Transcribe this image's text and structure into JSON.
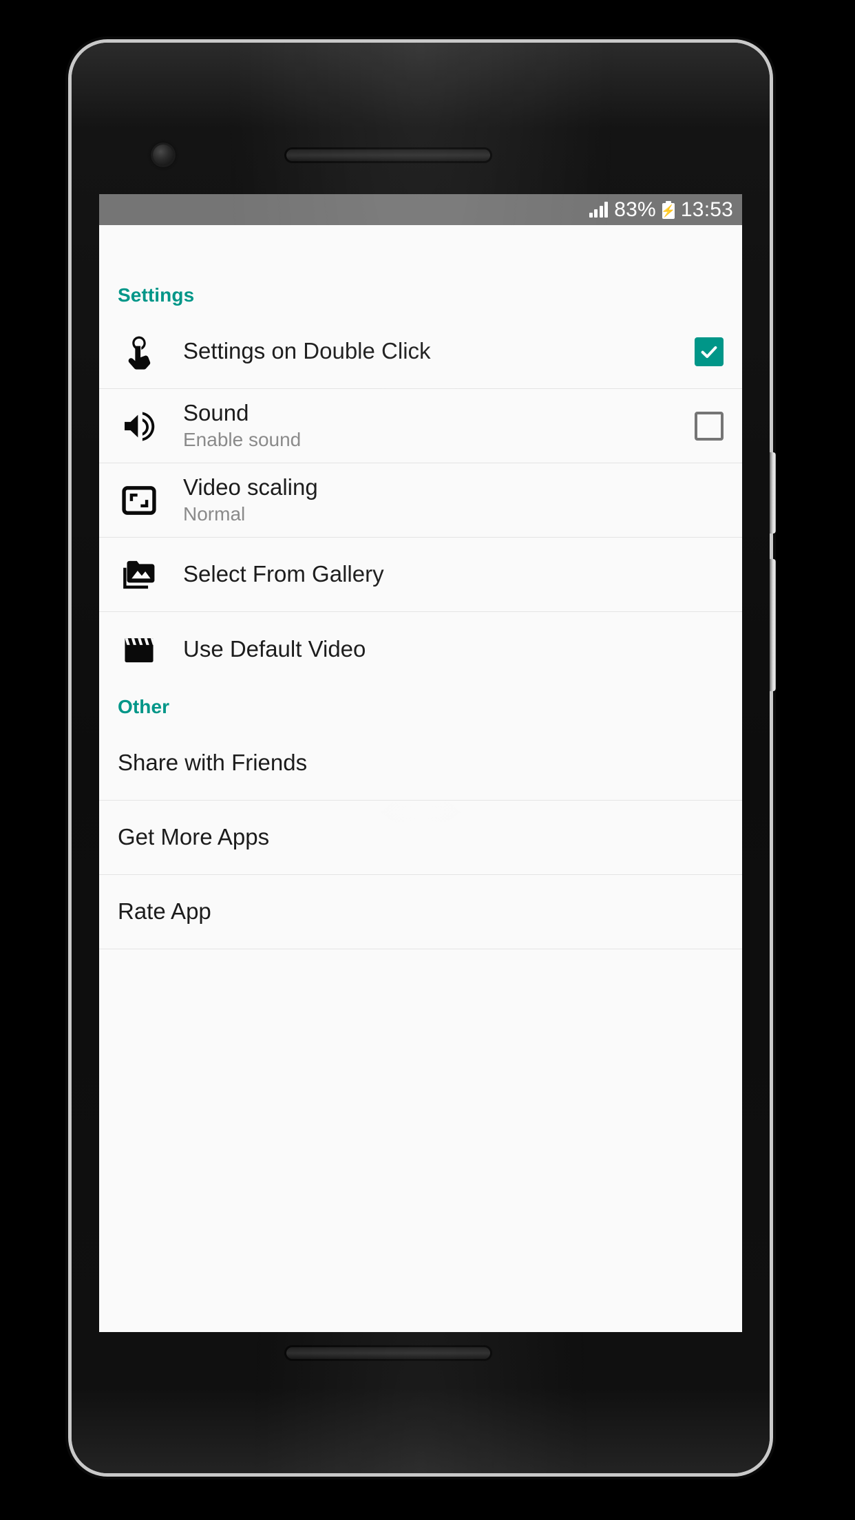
{
  "status_bar": {
    "signal_icon": "signal-bars-icon",
    "battery_percent": "83%",
    "battery_icon": "battery-charging-icon",
    "clock": "13:53"
  },
  "theme": {
    "accent": "#009688",
    "status_bar_bg": "#757575",
    "screen_bg": "#fafafa",
    "primary_text": "#1c1c1c",
    "secondary_text": "#8a8a8a",
    "divider": "#e4e4e4"
  },
  "sections": [
    {
      "header": "Settings",
      "items": [
        {
          "icon": "touch-tap-icon",
          "title": "Settings on Double Click",
          "summary": "",
          "widget": "checkbox",
          "checked": true
        },
        {
          "icon": "speaker-volume-icon",
          "title": "Sound",
          "summary": "Enable sound",
          "widget": "checkbox",
          "checked": false
        },
        {
          "icon": "fit-screen-icon",
          "title": "Video scaling",
          "summary": "Normal",
          "widget": "none",
          "checked": false
        },
        {
          "icon": "photo-library-icon",
          "title": "Select From Gallery",
          "summary": "",
          "widget": "none",
          "checked": false
        },
        {
          "icon": "movie-clapperboard-icon",
          "title": "Use Default Video",
          "summary": "",
          "widget": "none",
          "checked": false
        }
      ]
    },
    {
      "header": "Other",
      "items": [
        {
          "icon": "none",
          "title": "Share with Friends",
          "summary": "",
          "widget": "none",
          "checked": false
        },
        {
          "icon": "none",
          "title": "Get More Apps",
          "summary": "",
          "widget": "none",
          "checked": false
        },
        {
          "icon": "none",
          "title": "Rate App",
          "summary": "",
          "widget": "none",
          "checked": false
        }
      ]
    }
  ],
  "device": {
    "front_camera": "front-camera",
    "earpiece": "earpiece-speaker",
    "bottom_speaker": "bottom-speaker",
    "power_button": "power-button",
    "volume_button": "volume-button"
  }
}
